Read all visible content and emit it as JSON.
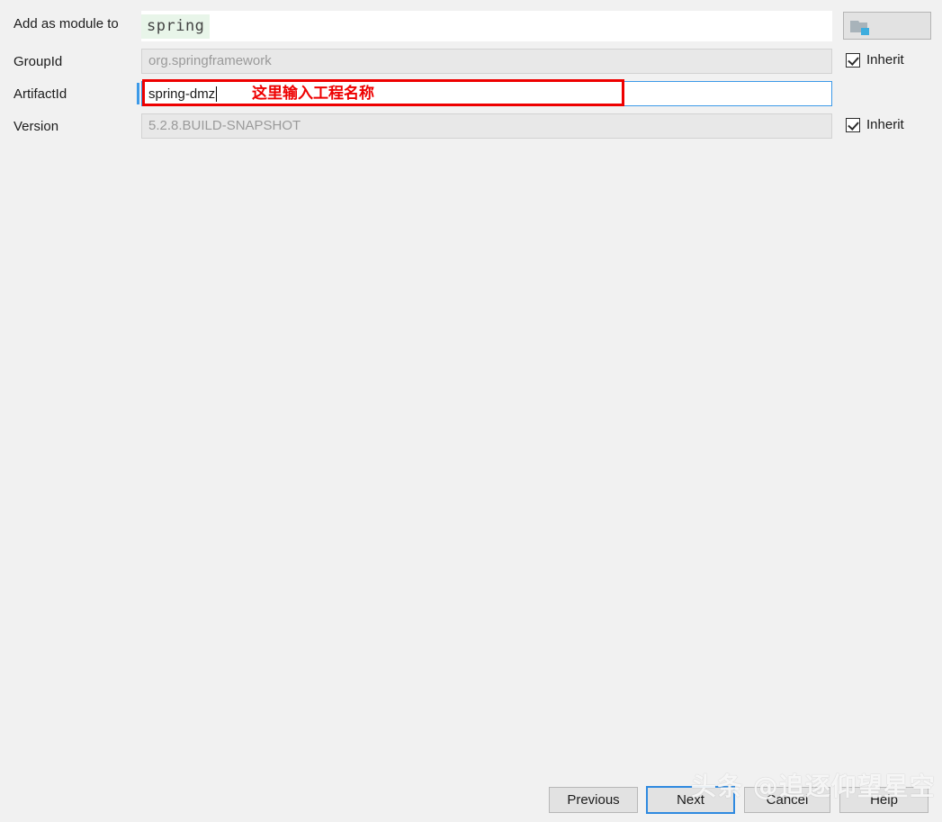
{
  "dialog": {
    "background_color": "#f1f1f1"
  },
  "form": {
    "rows": [
      {
        "label": "Add as module to",
        "value": "spring"
      },
      {
        "label": "GroupId",
        "value": "org.springframework"
      },
      {
        "label": "ArtifactId",
        "value": "spring-dmz"
      },
      {
        "label": "Version",
        "value": "5.2.8.BUILD-SNAPSHOT"
      }
    ],
    "module_label": "Add as module to",
    "module_value": "spring",
    "groupid_label": "GroupId",
    "groupid_value": "org.springframework",
    "artifactid_label": "ArtifactId",
    "artifactid_value": "spring-dmz",
    "version_label": "Version",
    "version_value": "5.2.8.BUILD-SNAPSHOT"
  },
  "inherit": {
    "groupid_label": "Inherit",
    "groupid_checked": true,
    "version_label": "Inherit",
    "version_checked": true
  },
  "browse": {
    "icon": "folder-icon",
    "accent_color": "#3dadde"
  },
  "annotation": {
    "text": "这里输入工程名称",
    "color": "#ee0000"
  },
  "buttons": {
    "previous": "Previous",
    "next": "Next",
    "cancel": "Cancel",
    "help": "Help",
    "focus_color": "#2f8ae0"
  },
  "watermark": {
    "text": "头条 @追逐仰望星空"
  }
}
